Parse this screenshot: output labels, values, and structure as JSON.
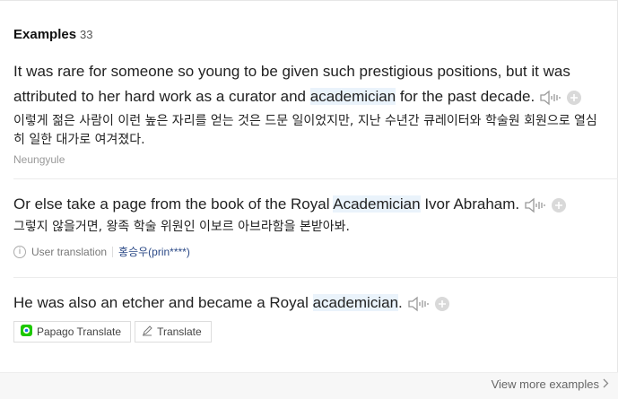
{
  "header": {
    "title": "Examples",
    "count": "33"
  },
  "examples": [
    {
      "en_parts": [
        "It was rare for someone so young to be given such prestigious positions, but it was attributed to her hard work as a curator and ",
        "academician",
        " for the past decade."
      ],
      "ko": "이렇게 젊은 사람이 이런 높은 자리를 얻는 것은 드문 일이었지만, 지난 수년간 큐레이터와 학술원 회원으로 열심히 일한 대가로 여겨졌다.",
      "source": "Neungyule"
    },
    {
      "en_parts": [
        "Or else take a page from the book of the Royal ",
        "Academician",
        " Ivor Abraham."
      ],
      "ko": "그렇지 않을거면, 왕족 학술 위원인 이보르 아브라함을 본받아봐.",
      "meta_label": "User translation",
      "meta_user": "홍승우(prin****)"
    },
    {
      "en_parts": [
        "He was also an etcher and became a Royal ",
        "academician",
        "."
      ]
    }
  ],
  "buttons": {
    "papago": "Papago Translate",
    "translate": "Translate"
  },
  "footer": {
    "more": "View more examples"
  },
  "icons": {
    "speaker": "speaker-icon",
    "add": "plus-circle-icon",
    "info": "info-icon",
    "papago": "papago-logo-icon",
    "pencil": "pencil-icon",
    "chevron": "chevron-right-icon"
  },
  "colors": {
    "highlight": "#eaf3fb",
    "user_link": "#2c4a87",
    "footer_bg": "#f7f7f7"
  }
}
